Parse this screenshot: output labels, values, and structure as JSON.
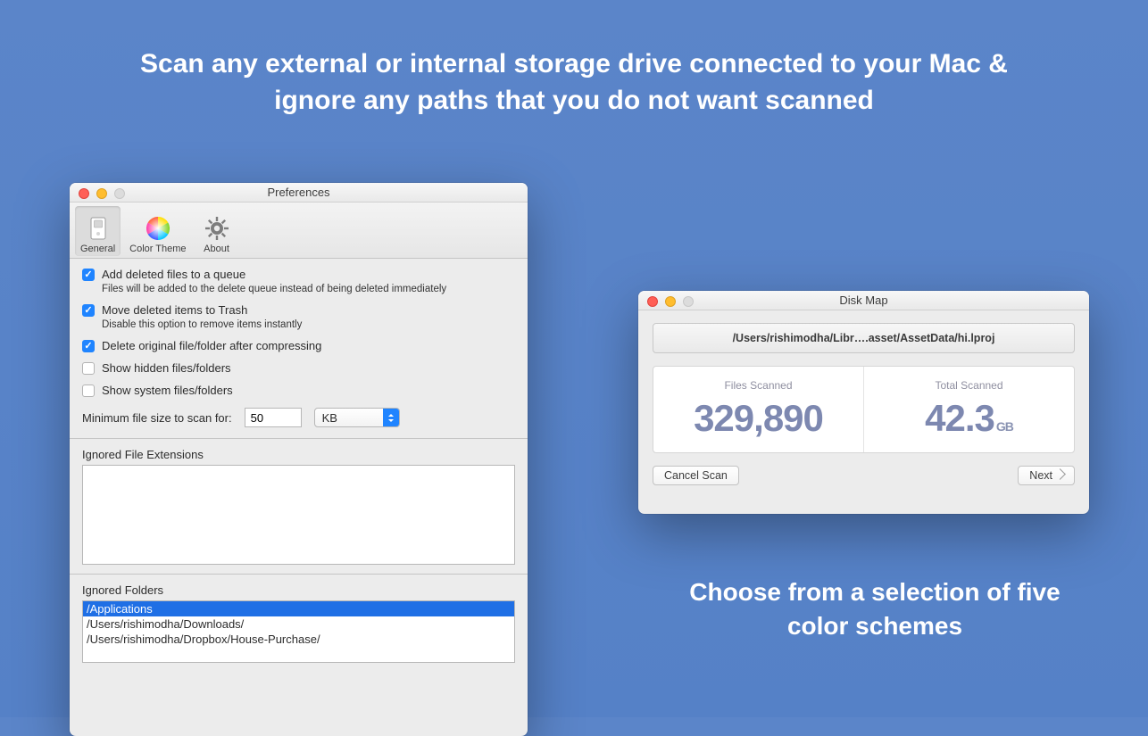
{
  "marketing": {
    "headline": "Scan any external or internal storage drive connected to your Mac & ignore any paths that you do not want scanned",
    "subheadline": "Choose from a selection of five color schemes"
  },
  "prefs": {
    "title": "Preferences",
    "toolbar": {
      "general": "General",
      "color_theme": "Color Theme",
      "about": "About"
    },
    "checks": {
      "queue_label": "Add deleted files to a queue",
      "queue_help": "Files will be added to the delete queue instead of being deleted immediately",
      "trash_label": "Move deleted items to Trash",
      "trash_help": "Disable this option to remove items instantly",
      "delete_after_compress": "Delete original file/folder after compressing",
      "show_hidden": "Show hidden files/folders",
      "show_system": "Show system files/folders"
    },
    "min_size_label": "Minimum file size to scan for:",
    "min_size_value": "50",
    "min_size_unit": "KB",
    "ignored_ext_label": "Ignored File Extensions",
    "ignored_folders_label": "Ignored Folders",
    "ignored_folders": [
      "/Applications",
      "/Users/rishimodha/Downloads/",
      "/Users/rishimodha/Dropbox/House-Purchase/"
    ]
  },
  "diskmap": {
    "title": "Disk Map",
    "path": "/Users/rishimodha/Libr….asset/AssetData/hi.lproj",
    "files_scanned_label": "Files Scanned",
    "files_scanned_value": "329,890",
    "total_scanned_label": "Total Scanned",
    "total_scanned_value": "42.3",
    "total_scanned_unit": "GB",
    "cancel": "Cancel Scan",
    "next": "Next"
  }
}
